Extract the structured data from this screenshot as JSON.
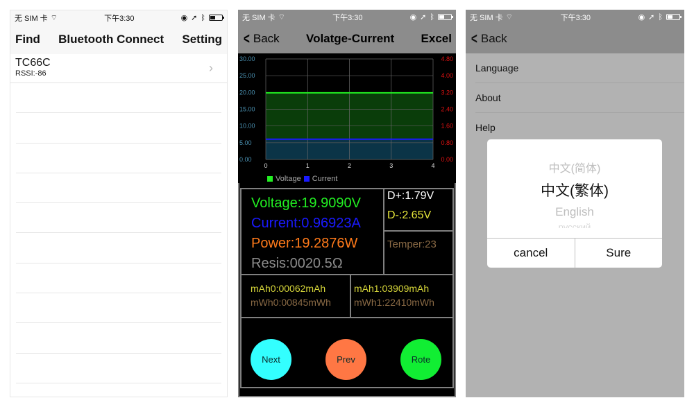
{
  "status_bar": {
    "carrier": "无 SIM 卡",
    "time": "下午3:30"
  },
  "screen1": {
    "nav": {
      "left": "Find",
      "title": "Bluetooth Connect",
      "right": "Setting"
    },
    "devices": [
      {
        "name": "TC66C",
        "rssi": "RSSI:-86"
      }
    ],
    "empty_rows": 10
  },
  "screen2": {
    "nav": {
      "back": "Back",
      "title": "Volatge-Current",
      "right": "Excel"
    },
    "readings": {
      "voltage": "Voltage:19.9090V",
      "current": "Current:0.96923A",
      "power": "Power:19.2876W",
      "resistance": "Resis:0020.5Ω",
      "d_plus": "D+:1.79V",
      "d_minus": "D-:2.65V",
      "temperature": "Temper:23",
      "mah0": "mAh0:00062mAh",
      "mwh0": "mWh0:00845mWh",
      "mah1": "mAh1:03909mAh",
      "mwh1": "mWh1:22410mWh"
    },
    "buttons": {
      "next": "Next",
      "prev": "Prev",
      "rote": "Rote"
    },
    "colors": {
      "voltage": "#22ee22",
      "current": "#1a1aff",
      "power": "#ff7a1a",
      "resistance": "#8c8c8c",
      "d_plus": "#ffffff",
      "d_minus": "#e8e83a",
      "mah": "#d8d83a",
      "mwh": "#8a6a45"
    }
  },
  "screen3": {
    "nav": {
      "back": "Back"
    },
    "menu": [
      "Language",
      "About",
      "Help"
    ],
    "dialog": {
      "options": [
        "中文(简体)",
        "中文(繁体)",
        "English",
        "русский"
      ],
      "selected": "中文(繁体)",
      "cancel": "cancel",
      "confirm": "Sure"
    }
  },
  "chart_data": {
    "type": "area",
    "x": [
      0,
      1,
      2,
      3,
      4
    ],
    "xlim": [
      0,
      4
    ],
    "x_ticks": [
      "0",
      "1",
      "2",
      "3",
      "4"
    ],
    "y_left": {
      "label": "",
      "ylim": [
        0,
        30
      ],
      "ticks": [
        "0.00",
        "5.00",
        "10.00",
        "15.00",
        "20.00",
        "25.00",
        "30.00"
      ],
      "color": "#4a90b0"
    },
    "y_right": {
      "label": "",
      "ylim": [
        0,
        4.8
      ],
      "ticks": [
        "0.00",
        "0.80",
        "1.60",
        "2.40",
        "3.20",
        "4.00",
        "4.80"
      ],
      "color": "#dd1111"
    },
    "series": [
      {
        "name": "Voltage",
        "axis": "left",
        "values": [
          19.9,
          19.9,
          19.9,
          19.9,
          19.9
        ],
        "color": "#22ee22",
        "fill": "#0a3d0a"
      },
      {
        "name": "Current",
        "axis": "right",
        "values": [
          0.97,
          0.97,
          0.97,
          0.97,
          0.97
        ],
        "color": "#1a1aff",
        "fill": "#0b3447"
      }
    ],
    "grid": true,
    "legend": "bottom"
  }
}
